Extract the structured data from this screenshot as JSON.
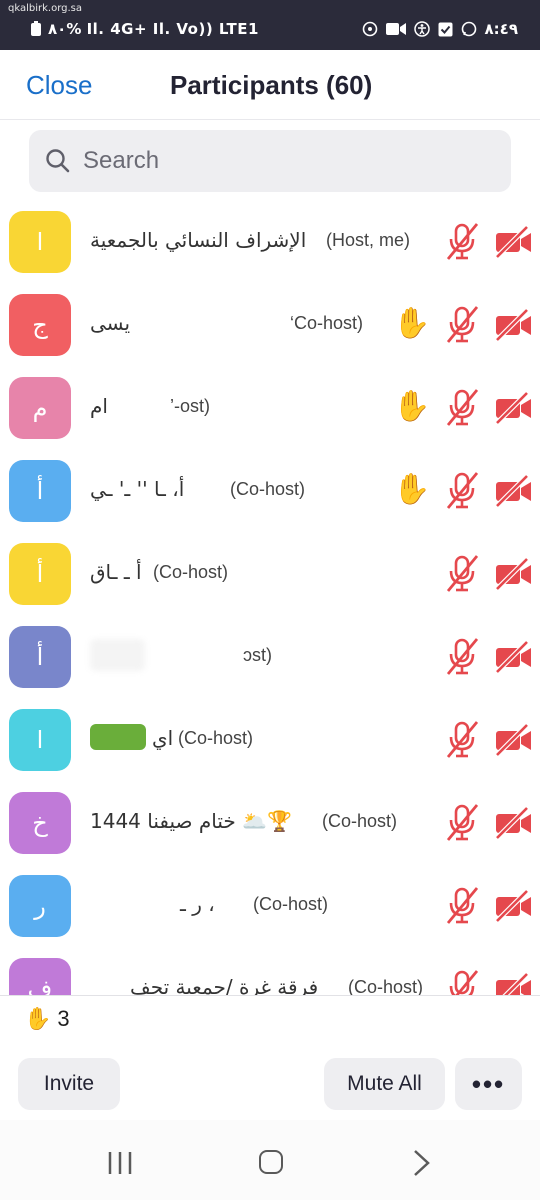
{
  "status_bar": {
    "watermark": "qkalbirk.org.sa",
    "left_text": "٨٠% Il. 4G+ Il. Vo)) LTE1",
    "time": "٨:٤٩"
  },
  "header": {
    "close_label": "Close",
    "title": "Participants (60)"
  },
  "search": {
    "placeholder": "Search"
  },
  "colors": {
    "accent": "#1a6fc9",
    "muted_red": "#e5484d"
  },
  "participants": [
    {
      "avatar_letter": "ا",
      "avatar_color": "#f9d634",
      "name": "الإشراف النسائي بالجمعية",
      "role": "(Host, me)",
      "hand_raised": false,
      "muted": true,
      "video_off": true
    },
    {
      "avatar_letter": "ج",
      "avatar_color": "#f15f62",
      "name": "يسى",
      "role": "‘Co-host)",
      "hand_raised": true,
      "muted": true,
      "video_off": true
    },
    {
      "avatar_letter": "م",
      "avatar_color": "#e784aa",
      "name": "ام",
      "role": "’-ost)",
      "hand_raised": true,
      "muted": true,
      "video_off": true
    },
    {
      "avatar_letter": "أ",
      "avatar_color": "#5aaef0",
      "name": "أ، ـا '' ـ' ـي",
      "role": "(Co-host)",
      "hand_raised": true,
      "muted": true,
      "video_off": true
    },
    {
      "avatar_letter": "أ",
      "avatar_color": "#f9d634",
      "name": "أ ـ ـاق",
      "role": "(Co-host)",
      "hand_raised": false,
      "muted": true,
      "video_off": true
    },
    {
      "avatar_letter": "أ",
      "avatar_color": "#7986cb",
      "name": "",
      "role": "ɔst)",
      "hand_raised": false,
      "muted": true,
      "video_off": true
    },
    {
      "avatar_letter": "ا",
      "avatar_color": "#4dd0e1",
      "name": "اي",
      "role": "(Co-host)",
      "hand_raised": false,
      "muted": true,
      "video_off": true
    },
    {
      "avatar_letter": "خ",
      "avatar_color": "#c07ad8",
      "name": "ختام صيفنا 1444 🌥️🏆",
      "role": "(Co-host)",
      "hand_raised": false,
      "muted": true,
      "video_off": true
    },
    {
      "avatar_letter": "ر",
      "avatar_color": "#5aaef0",
      "name": "ر ـ ،",
      "role": "(Co-host)",
      "hand_raised": false,
      "muted": true,
      "video_off": true
    },
    {
      "avatar_letter": "ف",
      "avatar_color": "#c07ad8",
      "name": "فرقة غرة /جمعية تحف",
      "role": "(Co-host)",
      "hand_raised": false,
      "muted": true,
      "video_off": true
    }
  ],
  "footer": {
    "raised_hands_count": "3",
    "invite_label": "Invite",
    "mute_all_label": "Mute All",
    "more_label": "•••"
  }
}
